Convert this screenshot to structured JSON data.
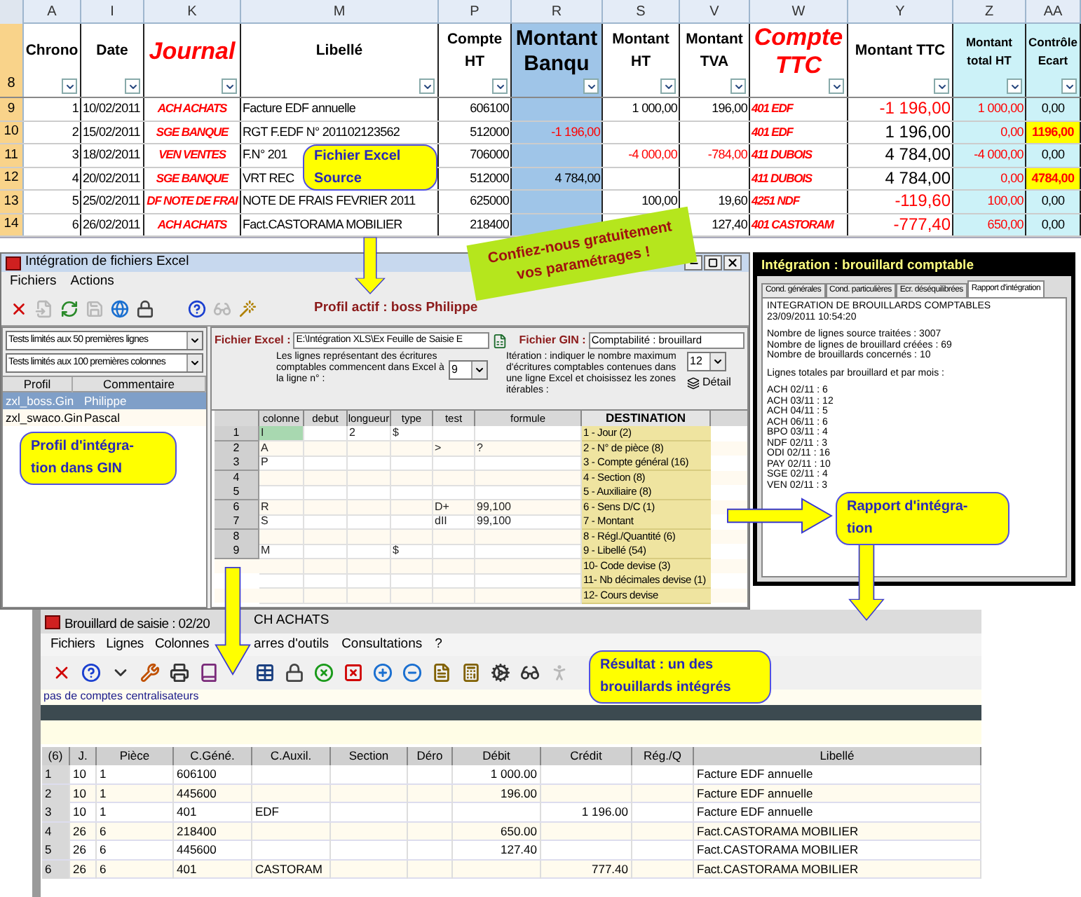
{
  "spreadsheet": {
    "column_letters": [
      "A",
      "I",
      "K",
      "M",
      "P",
      "R",
      "S",
      "V",
      "W",
      "Y",
      "Z",
      "AA"
    ],
    "header_row_number": "8",
    "headers": [
      {
        "label": "Chrono",
        "kind": "plain"
      },
      {
        "label": "Date",
        "kind": "plain"
      },
      {
        "label": "Journal",
        "kind": "accent"
      },
      {
        "label": "Libellé",
        "kind": "plain"
      },
      {
        "label": "Compte HT",
        "kind": "plain"
      },
      {
        "label": "Montant Banqu",
        "kind": "bank"
      },
      {
        "label": "Montant HT",
        "kind": "plain"
      },
      {
        "label": "Montant TVA",
        "kind": "plain"
      },
      {
        "label": "Compte TTC",
        "kind": "accent"
      },
      {
        "label": "Montant TTC",
        "kind": "plain"
      },
      {
        "label": "Montant total HT",
        "kind": "total"
      },
      {
        "label": "Contrôle Ecart",
        "kind": "total"
      }
    ],
    "rows": [
      {
        "number": "9",
        "cells": [
          {
            "text": "1",
            "red": false
          },
          {
            "text": "10/02/2011",
            "red": false
          },
          {
            "text": "ACH ACHATS",
            "red": true
          },
          {
            "text": "Facture EDF annuelle",
            "red": false
          },
          {
            "text": "606100",
            "red": false
          },
          null,
          {
            "text": "1 000,00",
            "red": false
          },
          {
            "text": "196,00",
            "red": false
          },
          {
            "text": "401 EDF",
            "red": true
          },
          {
            "text": "-1 196,00",
            "red": true
          },
          {
            "text": "1 000,00",
            "red": true
          },
          {
            "text": "0,00",
            "red": false,
            "highlight": false
          }
        ]
      },
      {
        "number": "10",
        "cells": [
          {
            "text": "2",
            "red": false
          },
          {
            "text": "15/02/2011",
            "red": false
          },
          {
            "text": "SGE BANQUE",
            "red": true
          },
          {
            "text": "RGT F.EDF N° 201102123562",
            "red": false
          },
          {
            "text": "512000",
            "red": false
          },
          {
            "text": "-1 196,00",
            "red": true
          },
          null,
          null,
          {
            "text": "401 EDF",
            "red": true
          },
          {
            "text": "1 196,00",
            "red": false
          },
          {
            "text": "0,00",
            "red": true
          },
          {
            "text": "1196,00",
            "red": true,
            "highlight": true
          }
        ]
      },
      {
        "number": "11",
        "cells": [
          {
            "text": "3",
            "red": false
          },
          {
            "text": "18/02/2011",
            "red": false
          },
          {
            "text": "VEN VENTES",
            "red": true
          },
          {
            "text": "F.N° 201",
            "red": false
          },
          {
            "text": "706000",
            "red": false
          },
          null,
          {
            "text": "-4 000,00",
            "red": true
          },
          {
            "text": "-784,00",
            "red": true
          },
          {
            "text": "411 DUBOIS",
            "red": true
          },
          {
            "text": "4 784,00",
            "red": false
          },
          {
            "text": "-4 000,00",
            "red": true
          },
          {
            "text": "0,00",
            "red": false,
            "highlight": false
          }
        ]
      },
      {
        "number": "12",
        "cells": [
          {
            "text": "4",
            "red": false
          },
          {
            "text": "20/02/2011",
            "red": false
          },
          {
            "text": "SGE BANQUE",
            "red": true
          },
          {
            "text": "VRT REC",
            "red": false
          },
          {
            "text": "512000",
            "red": false
          },
          {
            "text": "4 784,00",
            "red": false
          },
          null,
          null,
          {
            "text": "411 DUBOIS",
            "red": true
          },
          {
            "text": "4 784,00",
            "red": false
          },
          {
            "text": "0,00",
            "red": true
          },
          {
            "text": "4784,00",
            "red": true,
            "highlight": true
          }
        ]
      },
      {
        "number": "13",
        "cells": [
          {
            "text": "5",
            "red": false
          },
          {
            "text": "25/02/2011",
            "red": false
          },
          {
            "text": "DF NOTE DE FRAI",
            "red": true
          },
          {
            "text": "NOTE DE FRAIS FEVRIER 2011",
            "red": false
          },
          {
            "text": "625000",
            "red": false
          },
          null,
          {
            "text": "100,00",
            "red": false
          },
          {
            "text": "19,60",
            "red": false
          },
          {
            "text": "4251 NDF",
            "red": true
          },
          {
            "text": "-119,60",
            "red": true
          },
          {
            "text": "100,00",
            "red": true
          },
          {
            "text": "0,00",
            "red": false,
            "highlight": false
          }
        ]
      },
      {
        "number": "14",
        "cells": [
          {
            "text": "6",
            "red": false
          },
          {
            "text": "26/02/2011",
            "red": false
          },
          {
            "text": "ACH ACHATS",
            "red": true
          },
          {
            "text": "Fact.CASTORAMA MOBILIER",
            "red": false
          },
          {
            "text": "218400",
            "red": false
          },
          null,
          null,
          {
            "text": "127,40",
            "red": false
          },
          {
            "text": "401 CASTORAM",
            "red": true
          },
          {
            "text": "-777,40",
            "red": true
          },
          {
            "text": "650,00",
            "red": true
          },
          {
            "text": "0,00",
            "red": false,
            "highlight": false
          }
        ]
      }
    ]
  },
  "integration_window": {
    "title": "Intégration de fichiers Excel",
    "menu": [
      "Fichiers",
      "Actions"
    ],
    "toolbar": [
      {
        "kind": "close",
        "disabled": false
      },
      {
        "kind": "import",
        "disabled": true
      },
      {
        "kind": "refresh",
        "disabled": false
      },
      {
        "kind": "save",
        "disabled": true
      },
      {
        "kind": "globe",
        "disabled": false
      },
      {
        "kind": "lock",
        "disabled": false
      },
      {
        "kind": "help",
        "disabled": false
      },
      {
        "kind": "glasses",
        "disabled": true
      },
      {
        "kind": "wand",
        "disabled": false
      }
    ],
    "active_profile": "Profil actif : boss Philippe",
    "left_panel": {
      "dropdowns": [
        "Tests limités aux 50  premières lignes",
        "Tests limités aux 100  premières colonnes"
      ],
      "columns": [
        "Profil",
        "Commentaire"
      ],
      "profiles": [
        {
          "name": "zxl_boss.Gin",
          "comment": "Philippe",
          "selected": true
        },
        {
          "name": "zxl_swaco.Gin",
          "comment": "Pascal",
          "selected": false
        }
      ]
    },
    "form": {
      "excel_label": "Fichier Excel :",
      "excel_value": "E:\\Intégration XLS\\Ex Feuille de Saisie E",
      "gin_label": "Fichier GIN :",
      "gin_value": "Comptabilité : brouillard",
      "start_text": "Les lignes représentant des écritures comptables commencent dans Excel à la ligne n° :",
      "start_value": "9",
      "iteration_text": "Itération : indiquer le nombre maximum d'écritures comptables contenues dans une ligne Excel et choisissez les zones itérables :",
      "iteration_value": "12",
      "detail_button": "Détail"
    },
    "grid": {
      "columns": [
        "colonne",
        "debut",
        "longueur",
        "type",
        "test",
        "formule",
        "DESTINATION"
      ],
      "rows": [
        {
          "number": "1",
          "cells": [
            "I",
            null,
            "2",
            "$",
            null,
            null
          ],
          "destination": "1 - Jour (2)"
        },
        {
          "number": "2",
          "cells": [
            "A",
            null,
            null,
            null,
            ">",
            "?"
          ],
          "destination": "2 - N° de pièce (8)"
        },
        {
          "number": "3",
          "cells": [
            "P",
            null,
            null,
            null,
            null,
            null
          ],
          "destination": "3 - Compte général (16)"
        },
        {
          "number": "4",
          "cells": [
            null,
            null,
            null,
            null,
            null,
            null
          ],
          "destination": "4 - Section (8)"
        },
        {
          "number": "5",
          "cells": [
            null,
            null,
            null,
            null,
            null,
            null
          ],
          "destination": "5 - Auxiliaire (8)"
        },
        {
          "number": "6",
          "cells": [
            "R",
            null,
            null,
            null,
            "D+",
            "99,100"
          ],
          "destination": "6 - Sens D/C (1)"
        },
        {
          "number": "7",
          "cells": [
            "S",
            null,
            null,
            null,
            "dII",
            "99,100"
          ],
          "destination": "7 - Montant"
        },
        {
          "number": "8",
          "cells": [
            null,
            null,
            null,
            null,
            null,
            null
          ],
          "destination": "8 - Régl./Quantité (6)"
        },
        {
          "number": "9",
          "cells": [
            "M",
            null,
            null,
            "$",
            null,
            null
          ],
          "destination": "9 - Libellé (54)"
        },
        {
          "cells": [
            null,
            null,
            null,
            null,
            null,
            null
          ],
          "destination": "10- Code devise (3)"
        },
        {
          "cells": [
            null,
            null,
            null,
            null,
            null,
            null
          ],
          "destination": "11- Nb décimales devise (1)"
        },
        {
          "cells": [
            null,
            null,
            null,
            null,
            null,
            null
          ],
          "destination": "12- Cours devise"
        }
      ]
    }
  },
  "report_window": {
    "title": "Intégration : brouillard comptable",
    "tabs": [
      {
        "label": "Cond. générales",
        "selected": false
      },
      {
        "label": "Cond. particulières",
        "selected": false
      },
      {
        "label": "Ecr. déséquilibrées",
        "selected": false
      },
      {
        "label": "Rapport d'intégration",
        "selected": true
      }
    ],
    "report_blocks": [
      [
        "INTEGRATION DE BROUILLARDS COMPTABLES",
        "23/09/2011 10:54:20"
      ],
      [
        "Nombre de lignes source traitées : 3007",
        "Nombre de lignes de brouillard créées : 69",
        "Nombre de brouillards concernés : 10"
      ],
      [
        "Lignes totales par brouillard et par mois :"
      ],
      [
        "ACH 02/11 : 6",
        "ACH 03/11 : 12",
        "ACH 04/11 : 5",
        "ACH 06/11 : 6",
        "BPO 03/11 : 4",
        "NDF 02/11 : 3",
        "ODI 02/11 : 16",
        "PAY 02/11 : 10",
        "SGE 02/11 : 4",
        "VEN 02/11 : 3"
      ]
    ]
  },
  "journal_window": {
    "title_parts": [
      "Brouillard de saisie : 02/20",
      "CH ACHATS"
    ],
    "menu_groups": [
      [
        "Fichiers",
        "Lignes",
        "Colonnes"
      ],
      [
        "arres d'outils",
        "Consultations",
        "?"
      ]
    ],
    "toolbar_groups": [
      [
        {
          "kind": "close",
          "disabled": false
        },
        {
          "kind": "help",
          "disabled": false
        },
        {
          "kind": "dropdown",
          "disabled": false
        },
        {
          "kind": "tools",
          "disabled": false
        },
        {
          "kind": "print",
          "disabled": false
        },
        {
          "kind": "book",
          "disabled": false
        }
      ],
      [
        {
          "kind": "table",
          "disabled": false
        },
        {
          "kind": "lock",
          "disabled": false
        },
        {
          "kind": "delete",
          "disabled": false
        },
        {
          "kind": "cancel",
          "disabled": false
        },
        {
          "kind": "add",
          "disabled": false
        },
        {
          "kind": "remove",
          "disabled": false
        },
        {
          "kind": "document",
          "disabled": false
        },
        {
          "kind": "calculator",
          "disabled": false
        },
        {
          "kind": "settings",
          "disabled": false
        },
        {
          "kind": "glasses",
          "disabled": false
        },
        {
          "kind": "person",
          "disabled": true
        }
      ]
    ],
    "status": "pas de comptes centralisateurs",
    "grid": {
      "columns": [
        "(6)",
        "J.",
        "Pièce",
        "C.Géné.",
        "C.Auxil.",
        "Section",
        "Déro",
        "Débit",
        "Crédit",
        "Rég./Q",
        "Libellé"
      ],
      "rows": [
        {
          "cells": [
            "1",
            "10",
            "1",
            "606100",
            null,
            null,
            null,
            "1 000.00",
            null,
            null,
            "Facture EDF annuelle"
          ]
        },
        {
          "cells": [
            "2",
            "10",
            "1",
            "445600",
            null,
            null,
            null,
            "196.00",
            null,
            null,
            "Facture EDF annuelle"
          ]
        },
        {
          "cells": [
            "3",
            "10",
            "1",
            "401",
            "EDF",
            null,
            null,
            null,
            "1 196.00",
            null,
            "Facture EDF annuelle"
          ]
        },
        {
          "cells": [
            "4",
            "26",
            "6",
            "218400",
            null,
            null,
            null,
            "650.00",
            null,
            null,
            "Fact.CASTORAMA MOBILIER"
          ]
        },
        {
          "cells": [
            "5",
            "26",
            "6",
            "445600",
            null,
            null,
            null,
            "127.40",
            null,
            null,
            "Fact.CASTORAMA MOBILIER"
          ]
        },
        {
          "cells": [
            "6",
            "26",
            "6",
            "401",
            "CASTORAM",
            null,
            null,
            null,
            "777.40",
            null,
            "Fact.CASTORAMA MOBILIER"
          ]
        }
      ]
    }
  },
  "promo_banner": {
    "lines": [
      "Confiez-nous gratuitement",
      "vos paramétrages !"
    ]
  },
  "callouts": [
    {
      "lines": [
        "Fichier Excel",
        "Source"
      ]
    },
    {
      "lines": [
        "Profil d'intégra-",
        "tion dans GIN"
      ]
    },
    {
      "lines": [
        "Rapport d'intégra-",
        "tion"
      ]
    },
    {
      "lines": [
        "Résultat : un des",
        "brouillards intégrés"
      ]
    }
  ]
}
